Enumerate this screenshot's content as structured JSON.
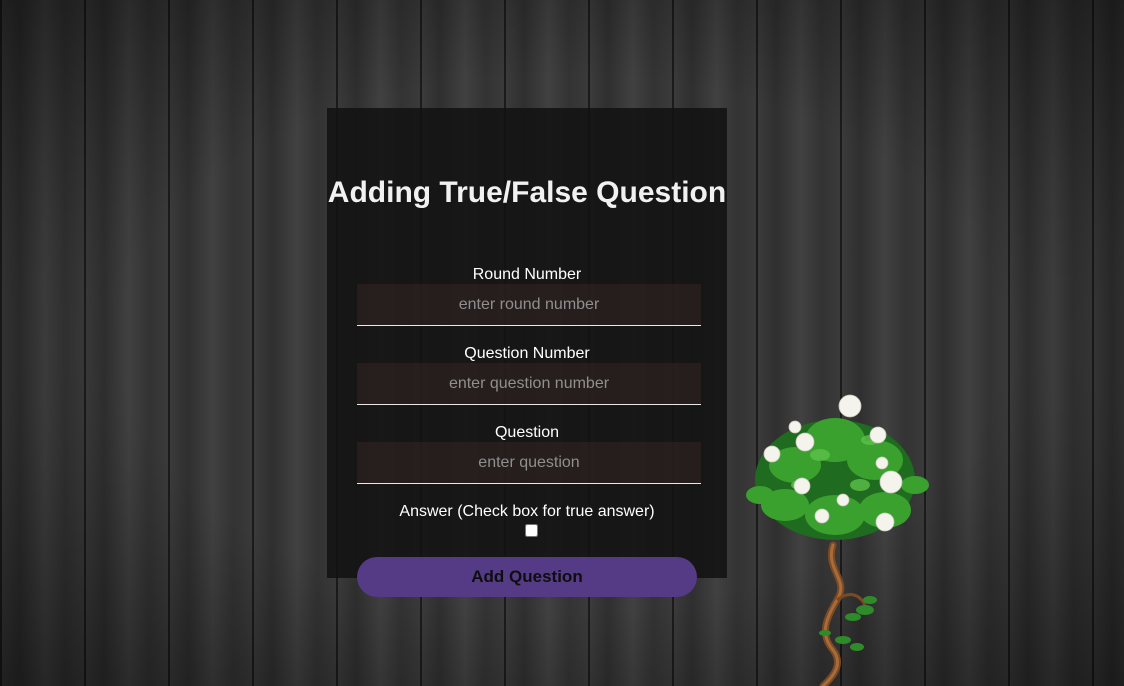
{
  "form": {
    "title": "Adding True/False Question",
    "round": {
      "label": "Round Number",
      "placeholder": "enter round number"
    },
    "question_number": {
      "label": "Question Number",
      "placeholder": "enter question number"
    },
    "question": {
      "label": "Question",
      "placeholder": "enter question"
    },
    "answer": {
      "label": "Answer (Check box for true answer)",
      "checked": false
    },
    "submit_label": "Add Question"
  },
  "colors": {
    "submit_button": "#553a85",
    "panel": "#121212",
    "input_background": "#302222"
  }
}
